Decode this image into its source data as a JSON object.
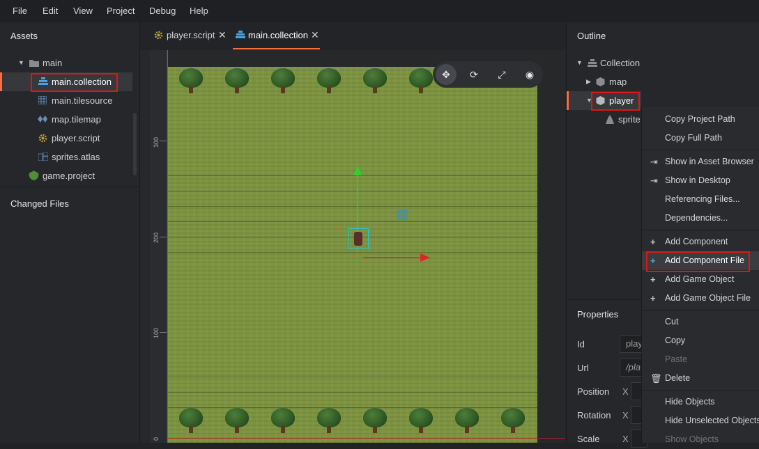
{
  "menubar": {
    "items": [
      "File",
      "Edit",
      "View",
      "Project",
      "Debug",
      "Help"
    ]
  },
  "assets": {
    "title": "Assets",
    "tree": [
      {
        "label": "main",
        "icon": "folder-icon"
      },
      {
        "label": "main.collection",
        "icon": "collection-icon"
      },
      {
        "label": "main.tilesource",
        "icon": "tilesource-icon"
      },
      {
        "label": "map.tilemap",
        "icon": "tilemap-icon"
      },
      {
        "label": "player.script",
        "icon": "script-gear-icon"
      },
      {
        "label": "sprites.atlas",
        "icon": "atlas-icon"
      },
      {
        "label": "game.project",
        "icon": "project-icon"
      }
    ],
    "changed_files_title": "Changed Files"
  },
  "tabs": [
    {
      "label": "player.script",
      "close": "✕"
    },
    {
      "label": "main.collection",
      "close": "✕"
    }
  ],
  "ruler": {
    "labels": [
      "300",
      "200",
      "100",
      "0"
    ]
  },
  "outline": {
    "title": "Outline",
    "tree": [
      {
        "label": "Collection"
      },
      {
        "label": "map"
      },
      {
        "label": "player"
      },
      {
        "label": "sprite"
      }
    ]
  },
  "properties": {
    "title": "Properties",
    "rows": [
      {
        "label": "Id",
        "value": "play"
      },
      {
        "label": "Url",
        "value": "/pla"
      },
      {
        "label": "Position",
        "axis": "X"
      },
      {
        "label": "Rotation",
        "axis": "X"
      },
      {
        "label": "Scale",
        "axis": "X"
      }
    ]
  },
  "context_menu": {
    "items": [
      {
        "label": "Copy Project Path",
        "icon": ""
      },
      {
        "label": "Copy Full Path",
        "icon": ""
      },
      {
        "label": "Show in Asset Browser",
        "icon": "reveal-icon"
      },
      {
        "label": "Show in Desktop",
        "icon": "reveal-icon"
      },
      {
        "label": "Referencing Files...",
        "icon": ""
      },
      {
        "label": "Dependencies...",
        "icon": ""
      },
      {
        "label": "Add Component",
        "icon": "plus-icon"
      },
      {
        "label": "Add Component File",
        "icon": "plus-icon"
      },
      {
        "label": "Add Game Object",
        "icon": "plus-icon"
      },
      {
        "label": "Add Game Object File",
        "icon": "plus-icon"
      },
      {
        "label": "Cut",
        "icon": ""
      },
      {
        "label": "Copy",
        "icon": ""
      },
      {
        "label": "Paste",
        "icon": ""
      },
      {
        "label": "Delete",
        "icon": "trash-icon"
      },
      {
        "label": "Hide Objects",
        "icon": ""
      },
      {
        "label": "Hide Unselected Objects",
        "icon": ""
      },
      {
        "label": "Show Objects",
        "icon": ""
      }
    ]
  },
  "colors": {
    "accent": "#ff6b3d",
    "highlight": "#e21515",
    "grass": "#7c9340"
  }
}
